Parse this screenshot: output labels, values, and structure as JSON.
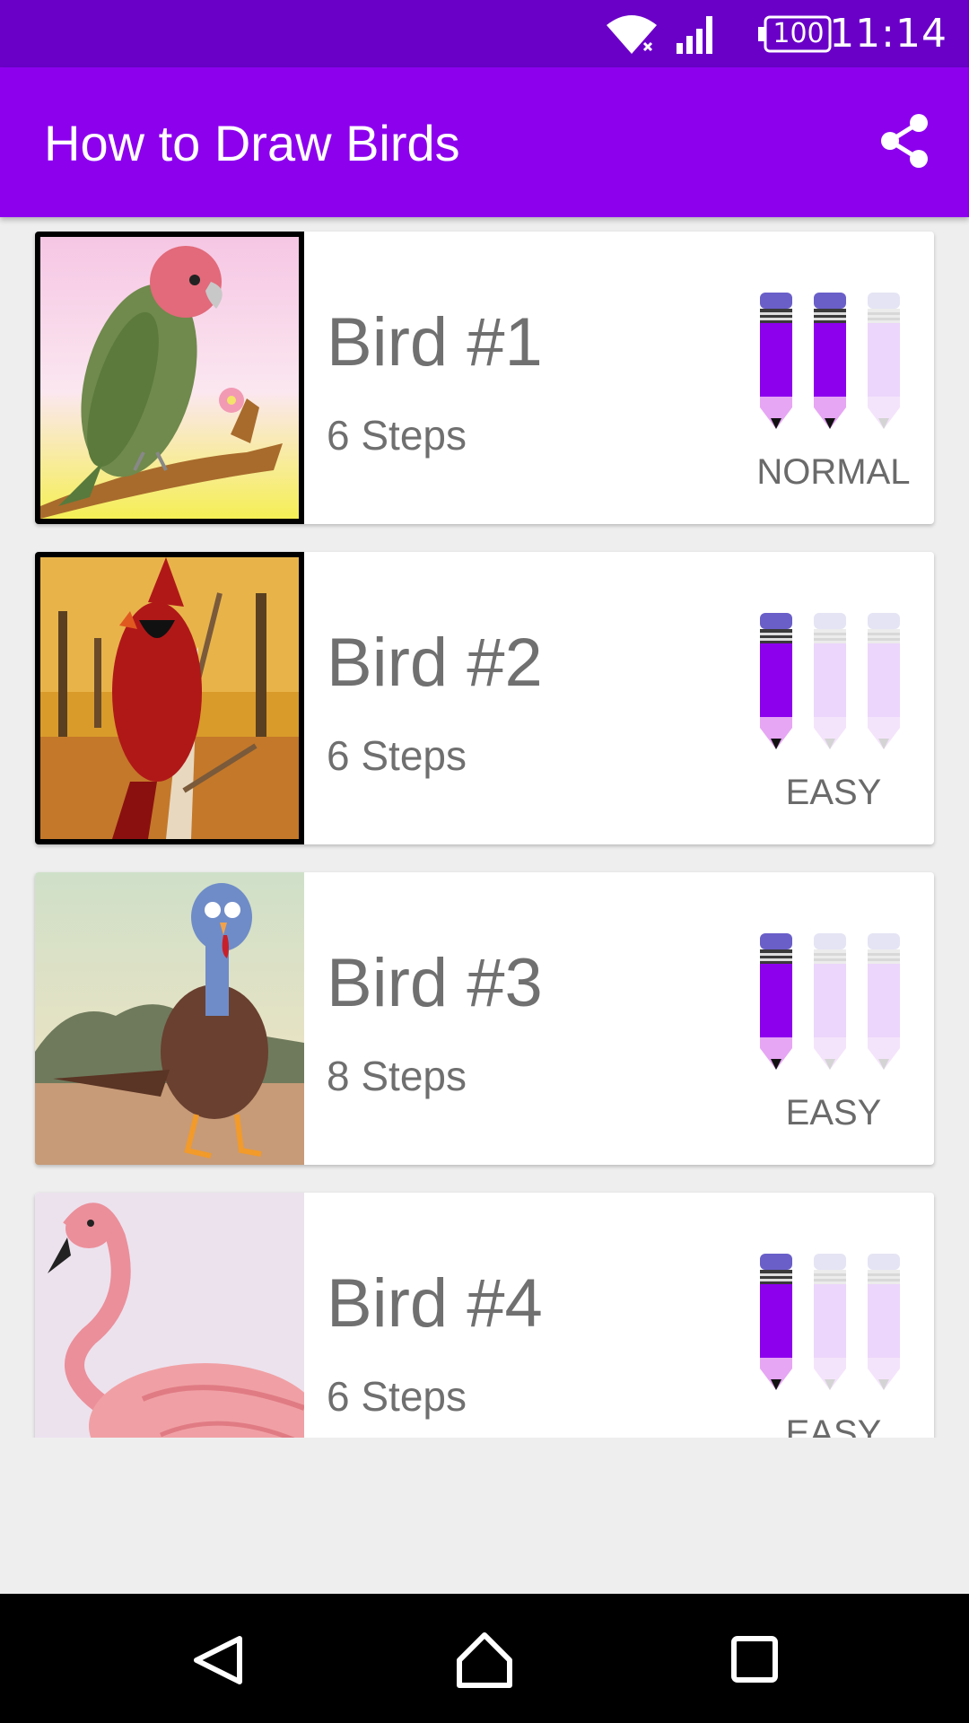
{
  "status_bar": {
    "time": "11:14",
    "battery": "100",
    "icons": [
      "wifi-icon",
      "signal-icon",
      "battery-icon"
    ]
  },
  "app_bar": {
    "title": "How to Draw Birds",
    "share_icon": "share-icon"
  },
  "colors": {
    "status_bar": "#6a00c8",
    "app_bar": "#8c00ee",
    "pencil_active": "#8c00ee",
    "pencil_inactive": "#ecd6fb",
    "background": "#eeeeee"
  },
  "birds": [
    {
      "title": "Bird #1",
      "steps": "6 Steps",
      "difficulty": "NORMAL",
      "pencils_filled": 2,
      "pencils_total": 3
    },
    {
      "title": "Bird #2",
      "steps": "6 Steps",
      "difficulty": "EASY",
      "pencils_filled": 1,
      "pencils_total": 3
    },
    {
      "title": "Bird #3",
      "steps": "8 Steps",
      "difficulty": "EASY",
      "pencils_filled": 1,
      "pencils_total": 3
    },
    {
      "title": "Bird #4",
      "steps": "6 Steps",
      "difficulty": "EASY",
      "pencils_filled": 1,
      "pencils_total": 3
    }
  ],
  "nav_bar": {
    "icons": [
      "back-icon",
      "home-icon",
      "recents-icon"
    ]
  }
}
